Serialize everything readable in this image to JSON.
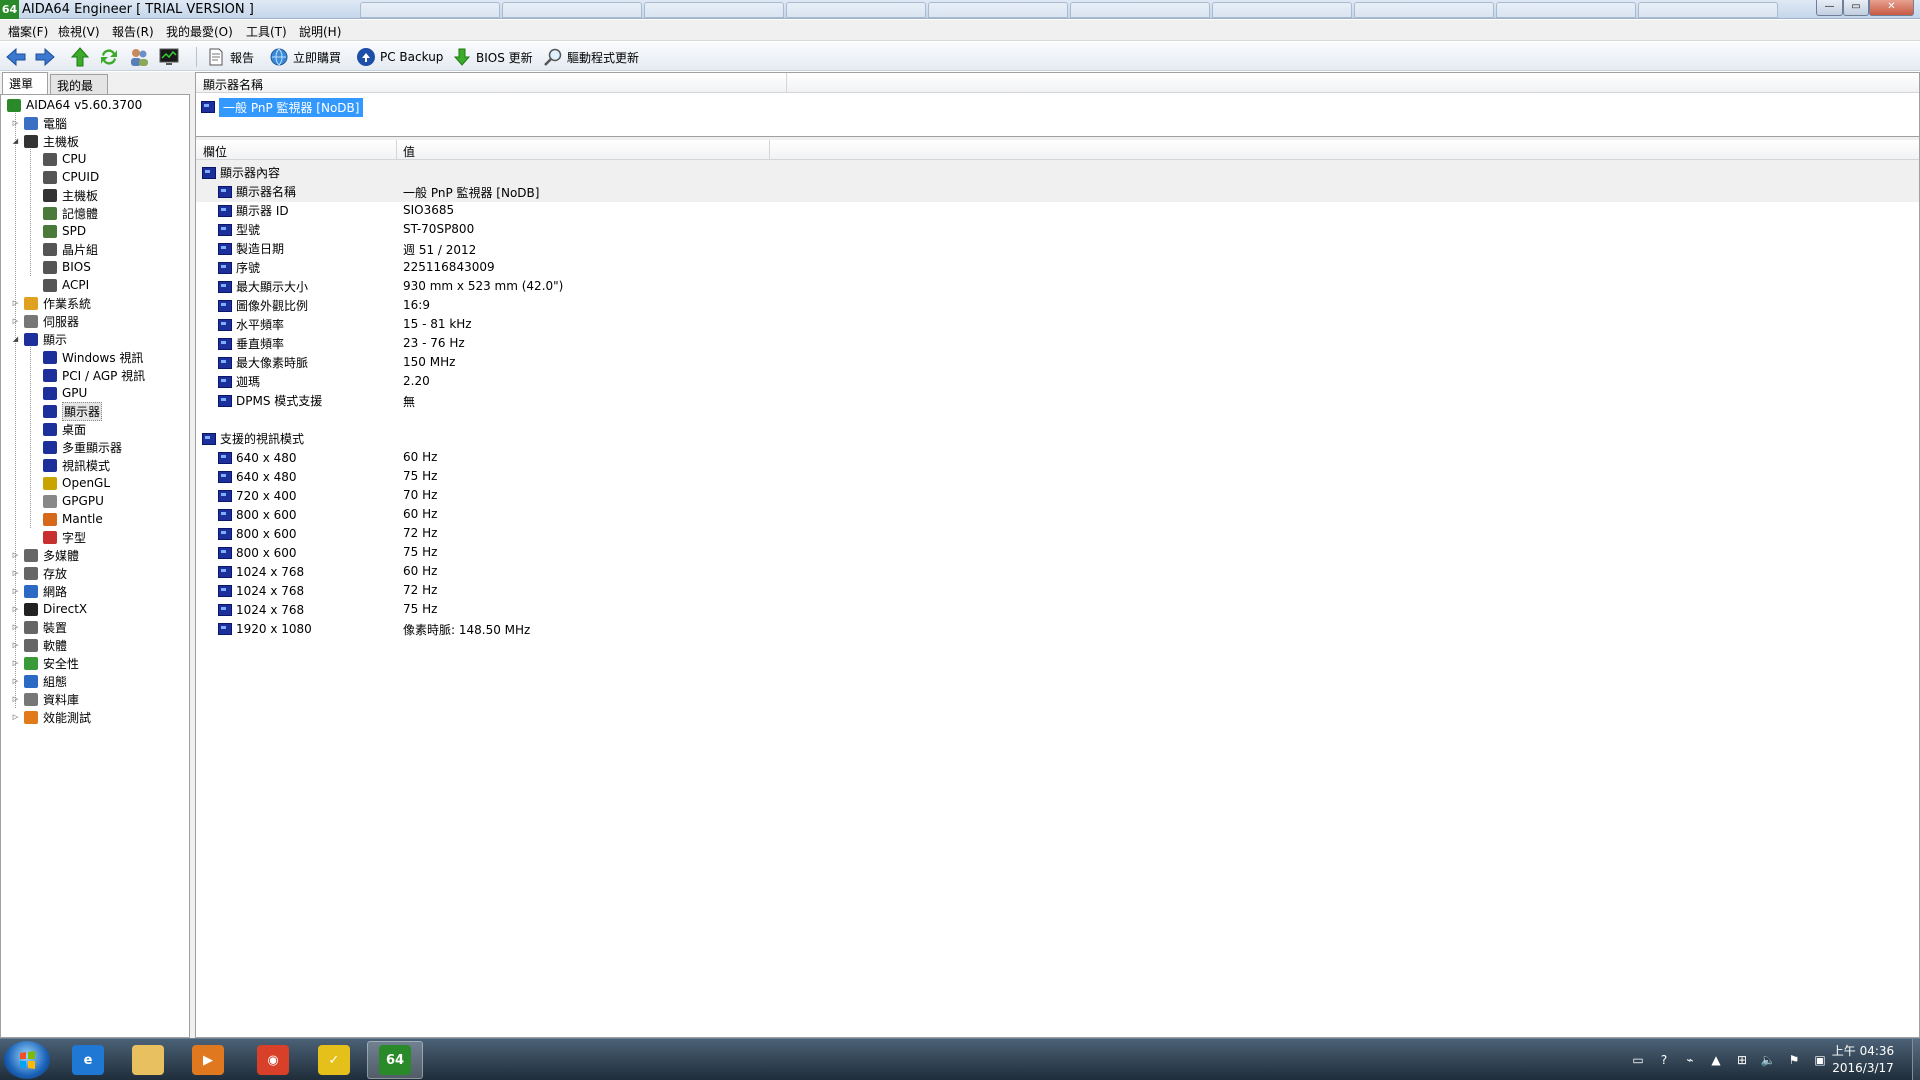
{
  "window": {
    "title": "AIDA64 Engineer  [ TRIAL VERSION ]",
    "app_icon_text": "64",
    "minimize": "—",
    "maximize": "▭",
    "close": "✕"
  },
  "menu": [
    "檔案(F)",
    "檢視(V)",
    "報告(R)",
    "我的最愛(O)",
    "工具(T)",
    "說明(H)"
  ],
  "toolbar": {
    "report": "報告",
    "buy_now": "立即購買",
    "pc_backup": "PC Backup",
    "bios_update": "BIOS 更新",
    "driver_update": "驅動程式更新"
  },
  "left_tabs": {
    "menu": "選單",
    "favorites": "我的最愛"
  },
  "tree": [
    {
      "label": "AIDA64 v5.60.3700",
      "icon": "aida64-icon",
      "color": "#2a8a2a"
    },
    {
      "label": "電腦",
      "icon": "computer-icon",
      "color": "#3a6fc4",
      "exp": "▷"
    },
    {
      "label": "主機板",
      "icon": "motherboard-icon",
      "color": "#333333",
      "exp": "◢"
    },
    {
      "label": "CPU",
      "icon": "cpu-icon",
      "color": "#555555"
    },
    {
      "label": "CPUID",
      "icon": "cpuid-icon",
      "color": "#555555"
    },
    {
      "label": "主機板",
      "icon": "motherboard-icon",
      "color": "#333333"
    },
    {
      "label": "記憶體",
      "icon": "memory-icon",
      "color": "#4a7a3a"
    },
    {
      "label": "SPD",
      "icon": "spd-icon",
      "color": "#4a7a3a"
    },
    {
      "label": "晶片組",
      "icon": "chipset-icon",
      "color": "#555555"
    },
    {
      "label": "BIOS",
      "icon": "bios-icon",
      "color": "#555555"
    },
    {
      "label": "ACPI",
      "icon": "acpi-icon",
      "color": "#555555"
    },
    {
      "label": "作業系統",
      "icon": "windows-icon",
      "color": "#e0a020",
      "exp": "▷"
    },
    {
      "label": "伺服器",
      "icon": "server-icon",
      "color": "#777777",
      "exp": "▷"
    },
    {
      "label": "顯示",
      "icon": "display-icon",
      "color": "#1c2f9a",
      "exp": "◢"
    },
    {
      "label": "Windows 視訊",
      "icon": "monitor-icon",
      "color": "#1c2f9a"
    },
    {
      "label": "PCI / AGP 視訊",
      "icon": "monitor-icon",
      "color": "#1c2f9a"
    },
    {
      "label": "GPU",
      "icon": "gpu-icon",
      "color": "#1c2f9a"
    },
    {
      "label": "顯示器",
      "icon": "monitor-icon",
      "color": "#1c2f9a"
    },
    {
      "label": "桌面",
      "icon": "desktop-icon",
      "color": "#1c2f9a"
    },
    {
      "label": "多重顯示器",
      "icon": "multi-monitor-icon",
      "color": "#1c2f9a"
    },
    {
      "label": "視訊模式",
      "icon": "video-mode-icon",
      "color": "#1c2f9a"
    },
    {
      "label": "OpenGL",
      "icon": "opengl-icon",
      "color": "#c9a400"
    },
    {
      "label": "GPGPU",
      "icon": "gpgpu-icon",
      "color": "#888888"
    },
    {
      "label": "Mantle",
      "icon": "mantle-icon",
      "color": "#d66a1a"
    },
    {
      "label": "字型",
      "icon": "font-icon",
      "color": "#c83030"
    },
    {
      "label": "多媒體",
      "icon": "speaker-icon",
      "color": "#666666",
      "exp": "▷"
    },
    {
      "label": "存放",
      "icon": "storage-icon",
      "color": "#666666",
      "exp": "▷"
    },
    {
      "label": "網路",
      "icon": "network-icon",
      "color": "#2a6ac4",
      "exp": "▷"
    },
    {
      "label": "DirectX",
      "icon": "directx-icon",
      "color": "#222222",
      "exp": "▷"
    },
    {
      "label": "裝置",
      "icon": "device-icon",
      "color": "#666666",
      "exp": "▷"
    },
    {
      "label": "軟體",
      "icon": "software-icon",
      "color": "#666666",
      "exp": "▷"
    },
    {
      "label": "安全性",
      "icon": "security-icon",
      "color": "#3a9a3a",
      "exp": "▷"
    },
    {
      "label": "組態",
      "icon": "config-icon",
      "color": "#2a6ac4",
      "exp": "▷"
    },
    {
      "label": "資料庫",
      "icon": "database-icon",
      "color": "#777777",
      "exp": "▷"
    },
    {
      "label": "效能測試",
      "icon": "benchmark-icon",
      "color": "#e07a1a",
      "exp": "▷"
    }
  ],
  "monitor_list": {
    "header": "顯示器名稱",
    "selected": "一般 PnP 監視器 [NoDB]"
  },
  "details": {
    "col_field": "欄位",
    "col_value": "值",
    "group1": "顯示器內容",
    "props": [
      {
        "field": "顯示器名稱",
        "value": "一般 PnP 監視器 [NoDB]"
      },
      {
        "field": "顯示器 ID",
        "value": "SIO3685"
      },
      {
        "field": "型號",
        "value": "ST-70SP800"
      },
      {
        "field": "製造日期",
        "value": "週 51 / 2012"
      },
      {
        "field": "序號",
        "value": "225116843009"
      },
      {
        "field": "最大顯示大小",
        "value": "930 mm x 523 mm (42.0\")"
      },
      {
        "field": "圖像外觀比例",
        "value": "16:9"
      },
      {
        "field": "水平頻率",
        "value": "15 - 81 kHz"
      },
      {
        "field": "垂直頻率",
        "value": "23 - 76 Hz"
      },
      {
        "field": "最大像素時脈",
        "value": "150 MHz"
      },
      {
        "field": "迦瑪",
        "value": "2.20"
      },
      {
        "field": "DPMS 模式支援",
        "value": "無"
      }
    ],
    "group2": "支援的視訊模式",
    "modes": [
      {
        "field": "640 x 480",
        "value": "60 Hz"
      },
      {
        "field": "640 x 480",
        "value": "75 Hz"
      },
      {
        "field": "720 x 400",
        "value": "70 Hz"
      },
      {
        "field": "800 x 600",
        "value": "60 Hz"
      },
      {
        "field": "800 x 600",
        "value": "72 Hz"
      },
      {
        "field": "800 x 600",
        "value": "75 Hz"
      },
      {
        "field": "1024 x 768",
        "value": "60 Hz"
      },
      {
        "field": "1024 x 768",
        "value": "72 Hz"
      },
      {
        "field": "1024 x 768",
        "value": "75 Hz"
      },
      {
        "field": "1920 x 1080",
        "value": "像素時脈: 148.50 MHz"
      }
    ]
  },
  "taskbar": {
    "apps": [
      {
        "name": "ie-icon",
        "text": "e",
        "color": "#1e78d4"
      },
      {
        "name": "explorer-icon",
        "text": "",
        "color": "#e8c060"
      },
      {
        "name": "media-player-icon",
        "text": "▶",
        "color": "#e07820"
      },
      {
        "name": "chrome-icon",
        "text": "◉",
        "color": "#d8402a"
      },
      {
        "name": "app-yellow-icon",
        "text": "✓",
        "color": "#e6c01a"
      },
      {
        "name": "aida64-taskbar-icon",
        "text": "64",
        "color": "#2a8a2a"
      }
    ],
    "clock_time": "上午 04:36",
    "clock_date": "2016/3/17"
  }
}
